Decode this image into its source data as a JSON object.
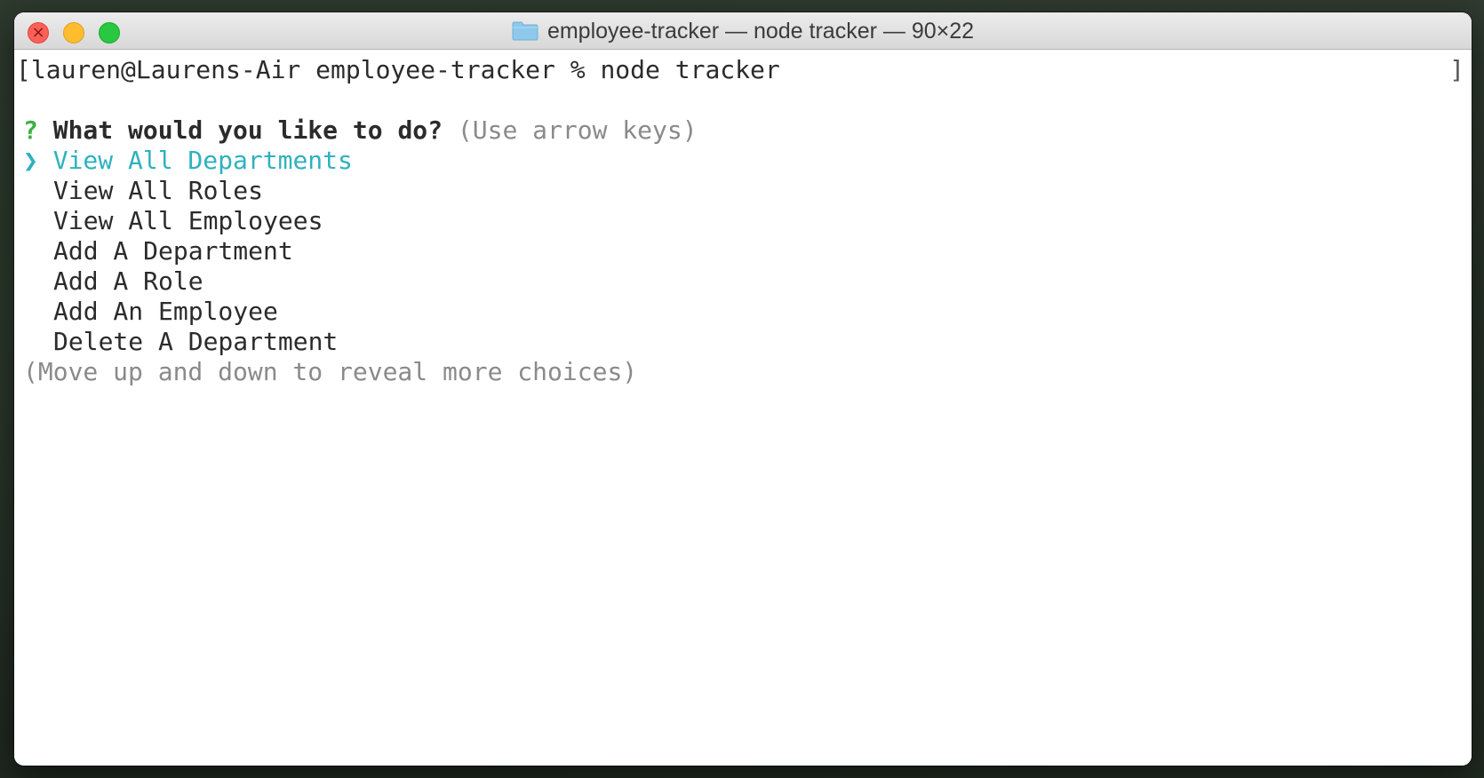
{
  "window": {
    "title": "employee-tracker — node tracker — 90×22"
  },
  "terminal": {
    "prompt_line_bracket_open": "[",
    "prompt_line": "lauren@Laurens-Air employee-tracker % node tracker",
    "prompt_line_bracket_close": "]",
    "question": {
      "marker": "?",
      "text": "What would you like to do?",
      "hint": "(Use arrow keys)"
    },
    "pointer": "❯",
    "choices": [
      "View All Departments",
      "View All Roles",
      "View All Employees",
      "Add A Department",
      "Add A Role",
      "Add An Employee",
      "Delete A Department"
    ],
    "selected_index": 0,
    "footer_hint": "(Move up and down to reveal more choices)"
  },
  "colors": {
    "accent_selected": "#2fb1c0",
    "question_marker": "#3cb043",
    "hint_text": "#8a8a8a"
  }
}
